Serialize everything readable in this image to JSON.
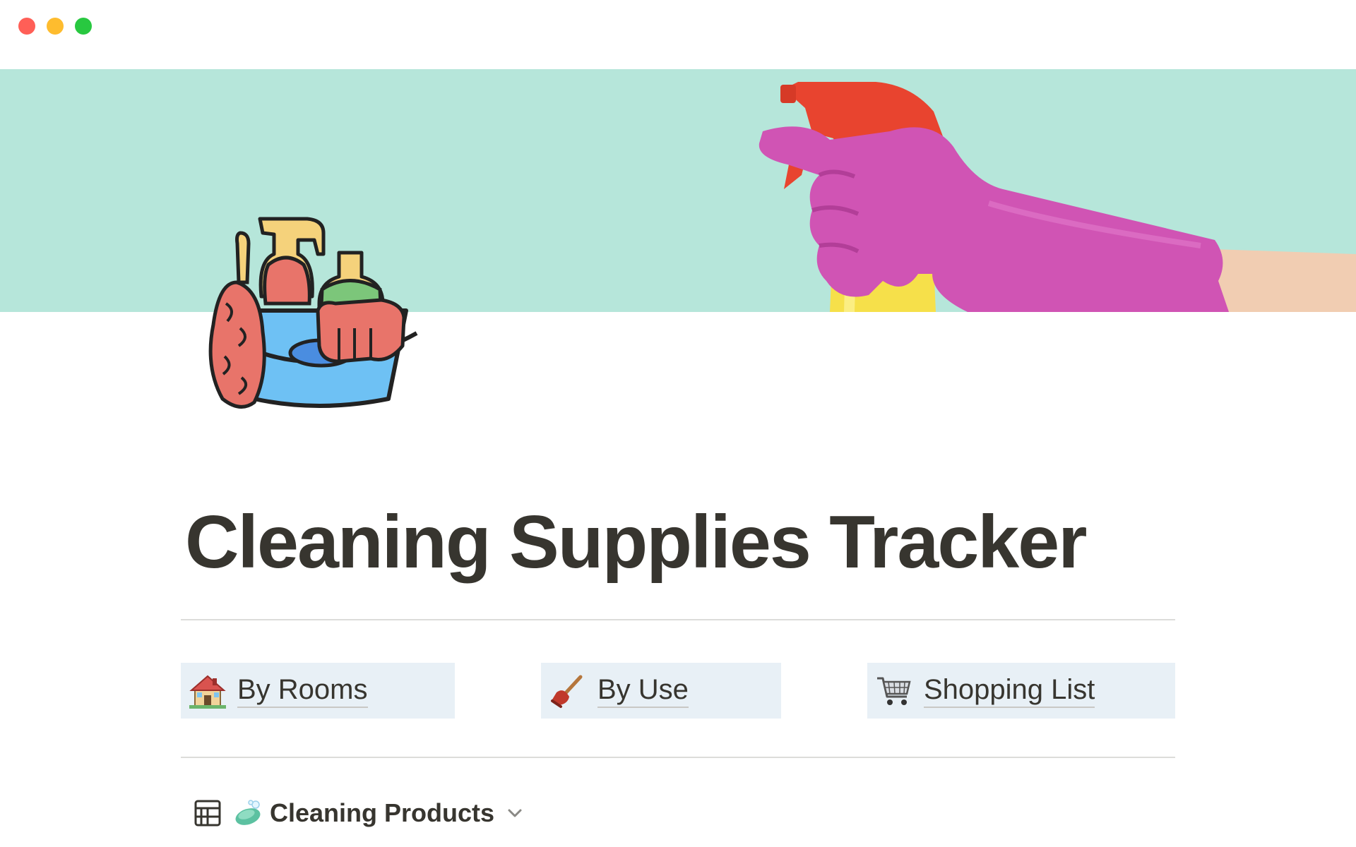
{
  "window": {
    "controls": [
      "close",
      "minimize",
      "maximize"
    ]
  },
  "cover": {
    "background_color": "#b6e6da",
    "image": "hand-in-pink-glove-holding-spray-bottle"
  },
  "page": {
    "icon": "cleaning-bucket-icon",
    "title": "Cleaning Supplies Tracker"
  },
  "links": [
    {
      "icon": "house-icon",
      "label": "By Rooms"
    },
    {
      "icon": "plunger-icon",
      "label": "By Use"
    },
    {
      "icon": "shopping-cart-icon",
      "label": "Shopping List"
    }
  ],
  "database": {
    "view_icon": "table-view-icon",
    "emoji": "soap-icon",
    "title": "Cleaning Products",
    "chevron": "chevron-down-icon"
  },
  "colors": {
    "text": "#37352f",
    "link_block_bg": "#e8f0f6",
    "divider": "#dcdcda",
    "close": "#ff5f57",
    "minimize": "#febc2e",
    "maximize": "#28c840"
  }
}
